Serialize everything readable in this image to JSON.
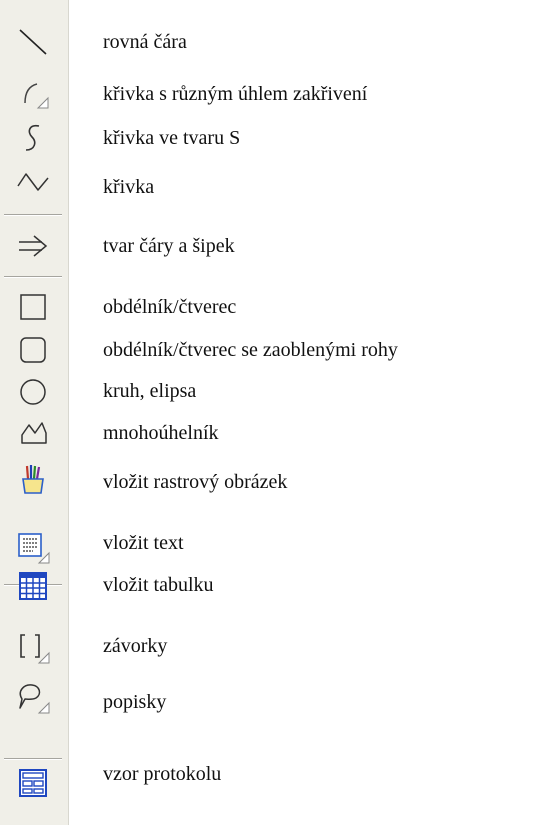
{
  "tools": [
    {
      "icon": "straight-line-icon",
      "label": "rovná čára"
    },
    {
      "icon": "arc-curve-icon",
      "label": "křivka s různým úhlem zakřivení"
    },
    {
      "icon": "s-curve-icon",
      "label": "křivka ve tvaru S"
    },
    {
      "icon": "wave-curve-icon",
      "label": "křivka"
    },
    {
      "icon": "line-arrow-icon",
      "label": "tvar čáry a šipek"
    },
    {
      "icon": "rectangle-icon",
      "label": "obdélník/čtverec"
    },
    {
      "icon": "rounded-rectangle-icon",
      "label": "obdélník/čtverec se zaoblenými rohy"
    },
    {
      "icon": "ellipse-icon",
      "label": "kruh, elipsa"
    },
    {
      "icon": "polygon-icon",
      "label": "mnohoúhelník"
    },
    {
      "icon": "raster-image-icon",
      "label": "vložit rastrový obrázek"
    },
    {
      "icon": "text-box-icon",
      "label": "vložit text"
    },
    {
      "icon": "table-icon",
      "label": "vložit tabulku"
    },
    {
      "icon": "brackets-icon",
      "label": "závorky"
    },
    {
      "icon": "callout-icon",
      "label": "popisky"
    },
    {
      "icon": "protocol-template-icon",
      "label": "vzor protokolu"
    }
  ]
}
